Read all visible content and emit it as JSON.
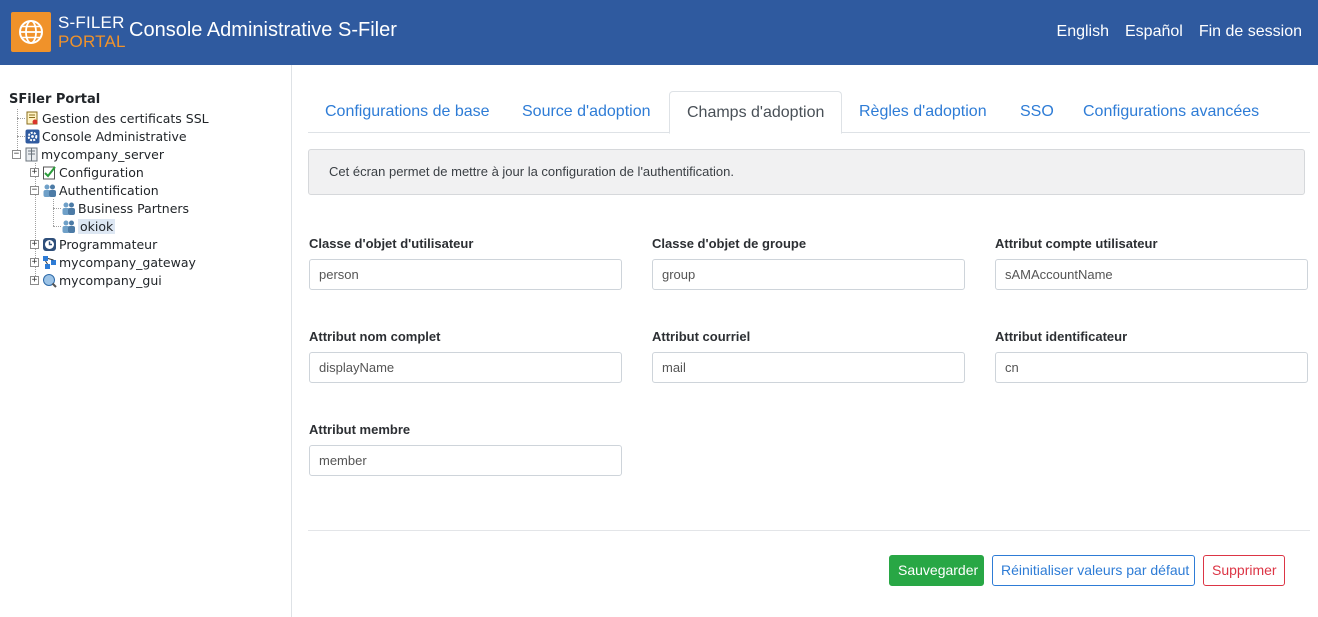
{
  "header": {
    "logo_line1": "S-FILER",
    "logo_line2": "PORTAL",
    "title": "Console Administrative S-Filer",
    "nav": [
      "English",
      "Español",
      "Fin de session"
    ],
    "colors": {
      "bar": "#2f5a9f",
      "logo": "#f0922a"
    }
  },
  "tree": {
    "root": "SFiler Portal",
    "items": [
      {
        "label": "Gestion des certificats SSL",
        "icon": "certificate-icon"
      },
      {
        "label": "Console Administrative",
        "icon": "gear-icon"
      },
      {
        "label": "mycompany_server",
        "icon": "server-icon",
        "expander": "−"
      },
      {
        "label": "Configuration",
        "icon": "checklist-icon",
        "expander": "+"
      },
      {
        "label": "Authentification",
        "icon": "users-icon",
        "expander": "−"
      },
      {
        "label": "Business Partners",
        "icon": "users-icon"
      },
      {
        "label": "okiok",
        "icon": "users-icon",
        "selected": true
      },
      {
        "label": "Programmateur",
        "icon": "clock-icon",
        "expander": "+"
      },
      {
        "label": "mycompany_gateway",
        "icon": "network-icon",
        "expander": "+"
      },
      {
        "label": "mycompany_gui",
        "icon": "globe-search-icon",
        "expander": "+"
      }
    ]
  },
  "tabs": [
    {
      "label": "Configurations de base"
    },
    {
      "label": "Source d'adoption"
    },
    {
      "label": "Champs d'adoption",
      "active": true
    },
    {
      "label": "Règles d'adoption"
    },
    {
      "label": "SSO"
    },
    {
      "label": "Configurations avancées"
    }
  ],
  "info": "Cet écran permet de mettre à jour la configuration de l'authentification.",
  "fields": [
    {
      "label": "Classe d'objet d'utilisateur",
      "value": "person"
    },
    {
      "label": "Classe d'objet de groupe",
      "value": "group"
    },
    {
      "label": "Attribut compte utilisateur",
      "value": "sAMAccountName"
    },
    {
      "label": "Attribut nom complet",
      "value": "displayName"
    },
    {
      "label": "Attribut courriel",
      "value": "mail"
    },
    {
      "label": "Attribut identificateur",
      "value": "cn"
    },
    {
      "label": "Attribut membre",
      "value": "member"
    }
  ],
  "buttons": {
    "save": "Sauvegarder",
    "reset": "Réinitialiser valeurs par défaut",
    "delete": "Supprimer"
  }
}
